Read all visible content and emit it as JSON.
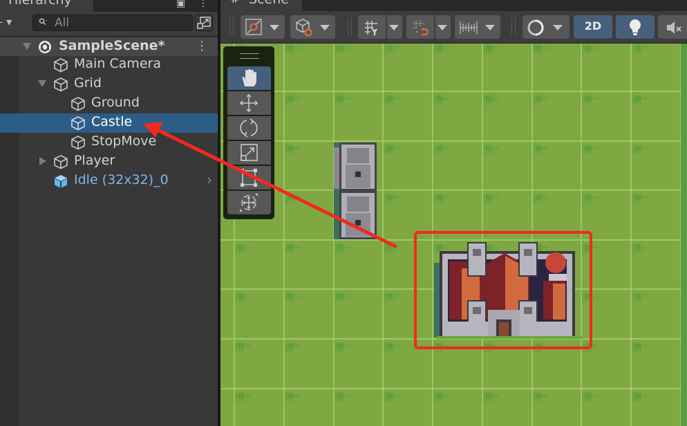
{
  "hierarchy": {
    "tab_label": "Hierarchy",
    "tab_icon": "hierarchy-list-icon",
    "add_button": "add-plus-dropdown",
    "search": {
      "placeholder": "All",
      "value": ""
    },
    "scene_root": {
      "label": "SampleScene*",
      "icon": "unity-scene-icon",
      "expanded": true
    },
    "items": [
      {
        "label": "Main Camera",
        "depth": 1,
        "icon": "gameobject-cube-icon",
        "foldout": "none",
        "selected": false
      },
      {
        "label": "Grid",
        "depth": 1,
        "icon": "gameobject-cube-icon",
        "foldout": "open",
        "selected": false
      },
      {
        "label": "Ground",
        "depth": 2,
        "icon": "gameobject-cube-icon",
        "foldout": "none",
        "selected": false
      },
      {
        "label": "Castle",
        "depth": 2,
        "icon": "gameobject-cube-icon",
        "foldout": "none",
        "selected": true
      },
      {
        "label": "StopMove",
        "depth": 2,
        "icon": "gameobject-cube-icon",
        "foldout": "none",
        "selected": false
      },
      {
        "label": "Player",
        "depth": 1,
        "icon": "gameobject-cube-icon",
        "foldout": "closed",
        "selected": false
      },
      {
        "label": "Idle (32x32)_0",
        "depth": 1,
        "icon": "prefab-cube-icon",
        "foldout": "none",
        "selected": false,
        "prefab": true
      }
    ]
  },
  "scene": {
    "tab_label": "Scene",
    "tab_icon": "hash-grid-icon",
    "toolbar": {
      "buttons": [
        {
          "name": "pivot-toggle",
          "icon": "pivot-icon"
        },
        {
          "name": "global-local-toggle",
          "icon": "cube-orbit-icon"
        },
        {
          "name": "grid-snapping-toggle",
          "icon": "grid-y-icon"
        },
        {
          "name": "incremental-snap-toggle",
          "icon": "grid-snap-magnet-icon"
        },
        {
          "name": "ruler-toggle",
          "icon": "ruler-icon"
        },
        {
          "name": "draw-mode",
          "icon": "shading-sphere-icon"
        },
        {
          "name": "2d-toggle",
          "label": "2D",
          "active": true
        },
        {
          "name": "lighting-toggle",
          "icon": "lightbulb-icon",
          "active": true
        },
        {
          "name": "audio-toggle",
          "icon": "mute-speaker-icon"
        }
      ]
    },
    "tools": [
      {
        "name": "view-tool",
        "icon": "hand-icon",
        "active": true
      },
      {
        "name": "move-tool",
        "icon": "move-arrows-icon",
        "active": false
      },
      {
        "name": "rotate-tool",
        "icon": "rotate-icon",
        "active": false
      },
      {
        "name": "scale-tool",
        "icon": "scale-icon",
        "active": false
      },
      {
        "name": "rect-tool",
        "icon": "rect-transform-icon",
        "active": false
      },
      {
        "name": "transform-tool",
        "icon": "transform-icon",
        "active": false
      }
    ],
    "colors": {
      "grass": "#7fa843",
      "grid_line": "#b8e07a",
      "annotation_red": "#f02a1e",
      "selection_blue": "#2c5d87",
      "prefab_blue": "#7cb5ec"
    },
    "annotation": {
      "type": "highlight-box-with-arrow",
      "target": "Castle"
    }
  }
}
